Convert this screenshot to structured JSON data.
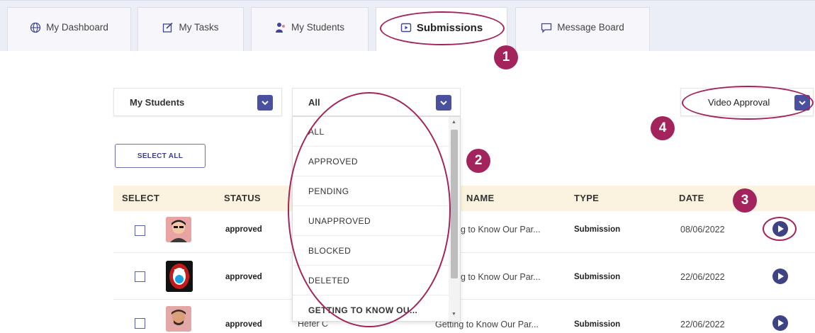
{
  "tabs": [
    {
      "label": "My Dashboard",
      "icon": "globe-icon"
    },
    {
      "label": "My Tasks",
      "icon": "edit-icon"
    },
    {
      "label": "My Students",
      "icon": "students-icon"
    },
    {
      "label": "Submissions",
      "icon": "video-icon"
    },
    {
      "label": "Message Board",
      "icon": "chat-icon"
    }
  ],
  "active_tab": "Submissions",
  "markers": [
    "1",
    "2",
    "3",
    "4"
  ],
  "filters": {
    "students_select": "My Students",
    "status_select": "All",
    "approval_select": "Video Approval"
  },
  "status_options": [
    "ALL",
    "APPROVED",
    "PENDING",
    "UNAPPROVED",
    "BLOCKED",
    "DELETED",
    "GETTING TO KNOW OU..."
  ],
  "select_all_label": "SELECT ALL",
  "table": {
    "headers": {
      "select": "SELECT",
      "status": "STATUS",
      "name": "NAME",
      "type": "TYPE",
      "date": "DATE"
    },
    "rows": [
      {
        "status": "approved",
        "student": "",
        "task_name": "g to Know Our Par...",
        "type": "Submission",
        "date": "08/06/2022"
      },
      {
        "status": "approved",
        "student": "",
        "task_name": "g to Know Our Par...",
        "type": "Submission",
        "date": "22/06/2022"
      },
      {
        "status": "approved",
        "student": "Hefer C",
        "task_name": "Getting to Know Our Par...",
        "type": "Submission",
        "date": "22/06/2022"
      }
    ]
  },
  "colors": {
    "accent": "#4a4f9e",
    "annotation": "#a3245c",
    "header_bg": "#fbf3df",
    "tabbar_bg": "#eceef7"
  }
}
